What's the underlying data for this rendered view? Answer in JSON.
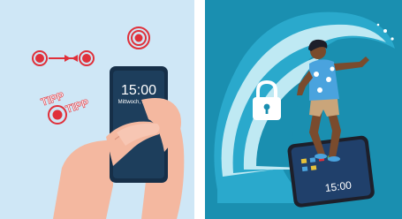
{
  "left_panel": {
    "phone": {
      "time": "15:00",
      "date": "Mittwoch, 17. Mai"
    },
    "tap_labels": [
      "TIPP",
      "TIPP"
    ],
    "colors": {
      "background": "#cfe7f6",
      "tap_ring": "#e0303a",
      "skin": "#f4b8a0",
      "phone_screen": "#1d3e5c"
    },
    "icons": [
      "tap-target-icon",
      "swipe-arrow-icon"
    ]
  },
  "right_panel": {
    "phone": {
      "time": "15:00"
    },
    "colors": {
      "background": "#1a8fb0",
      "wave_light": "#bfe9f3",
      "wave_dark": "#2aa9cc",
      "shirt": "#4aa3de"
    },
    "icons": [
      "padlock-icon"
    ]
  }
}
